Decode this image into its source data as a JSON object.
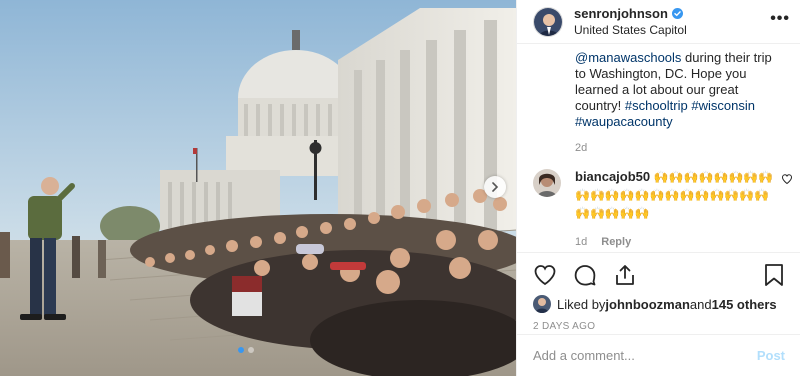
{
  "post": {
    "username": "senronjohnson",
    "location": "United States Capitol",
    "more_glyph": "•••"
  },
  "caption": {
    "mention": "@manawaschools",
    "text": " during their trip to Washington, DC. Hope you learned a lot about our great country! ",
    "hashtags": [
      "#schooltrip",
      "#wisconsin",
      "#waupacacounty"
    ],
    "time": "2d"
  },
  "comments": [
    {
      "username": "biancajob50",
      "emoji_text": "🙌🙌🙌🙌🙌🙌🙌🙌🙌🙌🙌🙌🙌🙌🙌🙌🙌🙌🙌🙌🙌🙌🙌🙌🙌🙌",
      "time": "1d",
      "reply_label": "Reply"
    }
  ],
  "likes": {
    "prefix": "Liked by ",
    "user": "johnboozman",
    "middle": " and ",
    "others": "145 others"
  },
  "post_date": "2 DAYS AGO",
  "comment_box": {
    "placeholder": "Add a comment...",
    "post_label": "Post"
  },
  "carousel": {
    "count": 2,
    "active_index": 0
  },
  "icons": {
    "verified": "verified-badge-icon",
    "heart": "heart-icon",
    "comment": "comment-icon",
    "share": "share-icon",
    "save": "bookmark-icon",
    "next": "chevron-right-icon"
  },
  "colors": {
    "link": "#003569",
    "verified": "#3897f0",
    "post_disabled": "#b2dffc",
    "muted": "#8e8e8e"
  }
}
